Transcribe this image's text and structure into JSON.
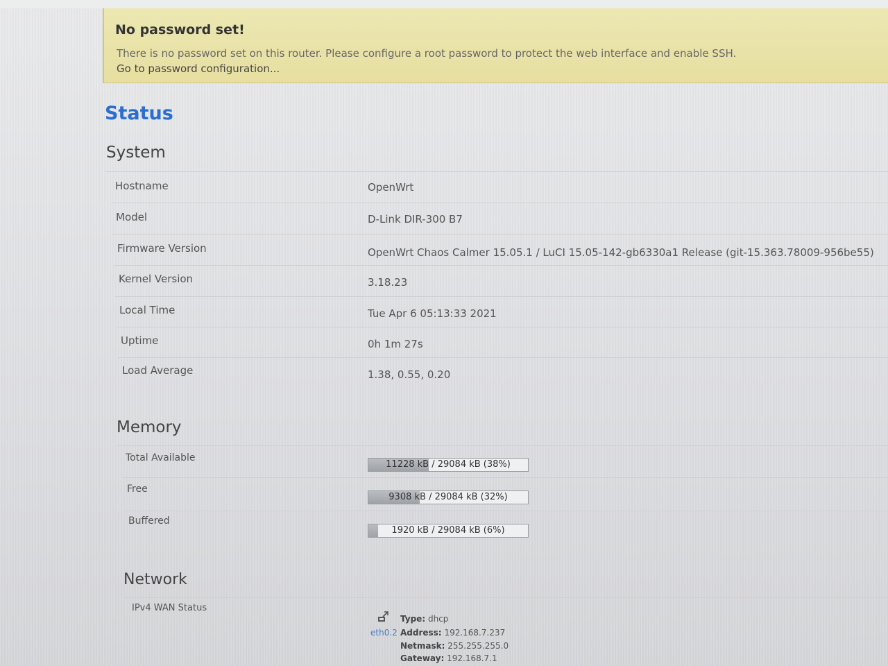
{
  "alert": {
    "title": "No password set!",
    "text": "There is no password set on this router. Please configure a root password to protect the web interface and enable SSH.",
    "link": "Go to password configuration..."
  },
  "page_title": "Status",
  "system": {
    "title": "System",
    "rows": [
      {
        "label": "Hostname",
        "value": "OpenWrt"
      },
      {
        "label": "Model",
        "value": "D-Link DIR-300 B7"
      },
      {
        "label": "Firmware Version",
        "value": "OpenWrt Chaos Calmer 15.05.1 / LuCI 15.05-142-gb6330a1 Release (git-15.363.78009-956be55)"
      },
      {
        "label": "Kernel Version",
        "value": "3.18.23"
      },
      {
        "label": "Local Time",
        "value": "Tue Apr 6 05:13:33 2021"
      },
      {
        "label": "Uptime",
        "value": "0h 1m 27s"
      },
      {
        "label": "Load Average",
        "value": "1.38, 0.55, 0.20"
      }
    ]
  },
  "memory": {
    "title": "Memory",
    "rows": [
      {
        "label": "Total Available",
        "text": "11228 kB / 29084 kB (38%)",
        "fraction": 0.38
      },
      {
        "label": "Free",
        "text": "9308 kB / 29084 kB (32%)",
        "fraction": 0.32
      },
      {
        "label": "Buffered",
        "text": "1920 kB / 29084 kB (6%)",
        "fraction": 0.06
      }
    ]
  },
  "network": {
    "title": "Network",
    "wan_label": "IPv4 WAN Status",
    "iface": "eth0.2",
    "type_label": "Type:",
    "type_value": "dhcp",
    "address_label": "Address:",
    "address_value": "192.168.7.237",
    "netmask_label": "Netmask:",
    "netmask_value": "255.255.255.0",
    "gateway_label": "Gateway:",
    "gateway_value": "192.168.7.1"
  }
}
